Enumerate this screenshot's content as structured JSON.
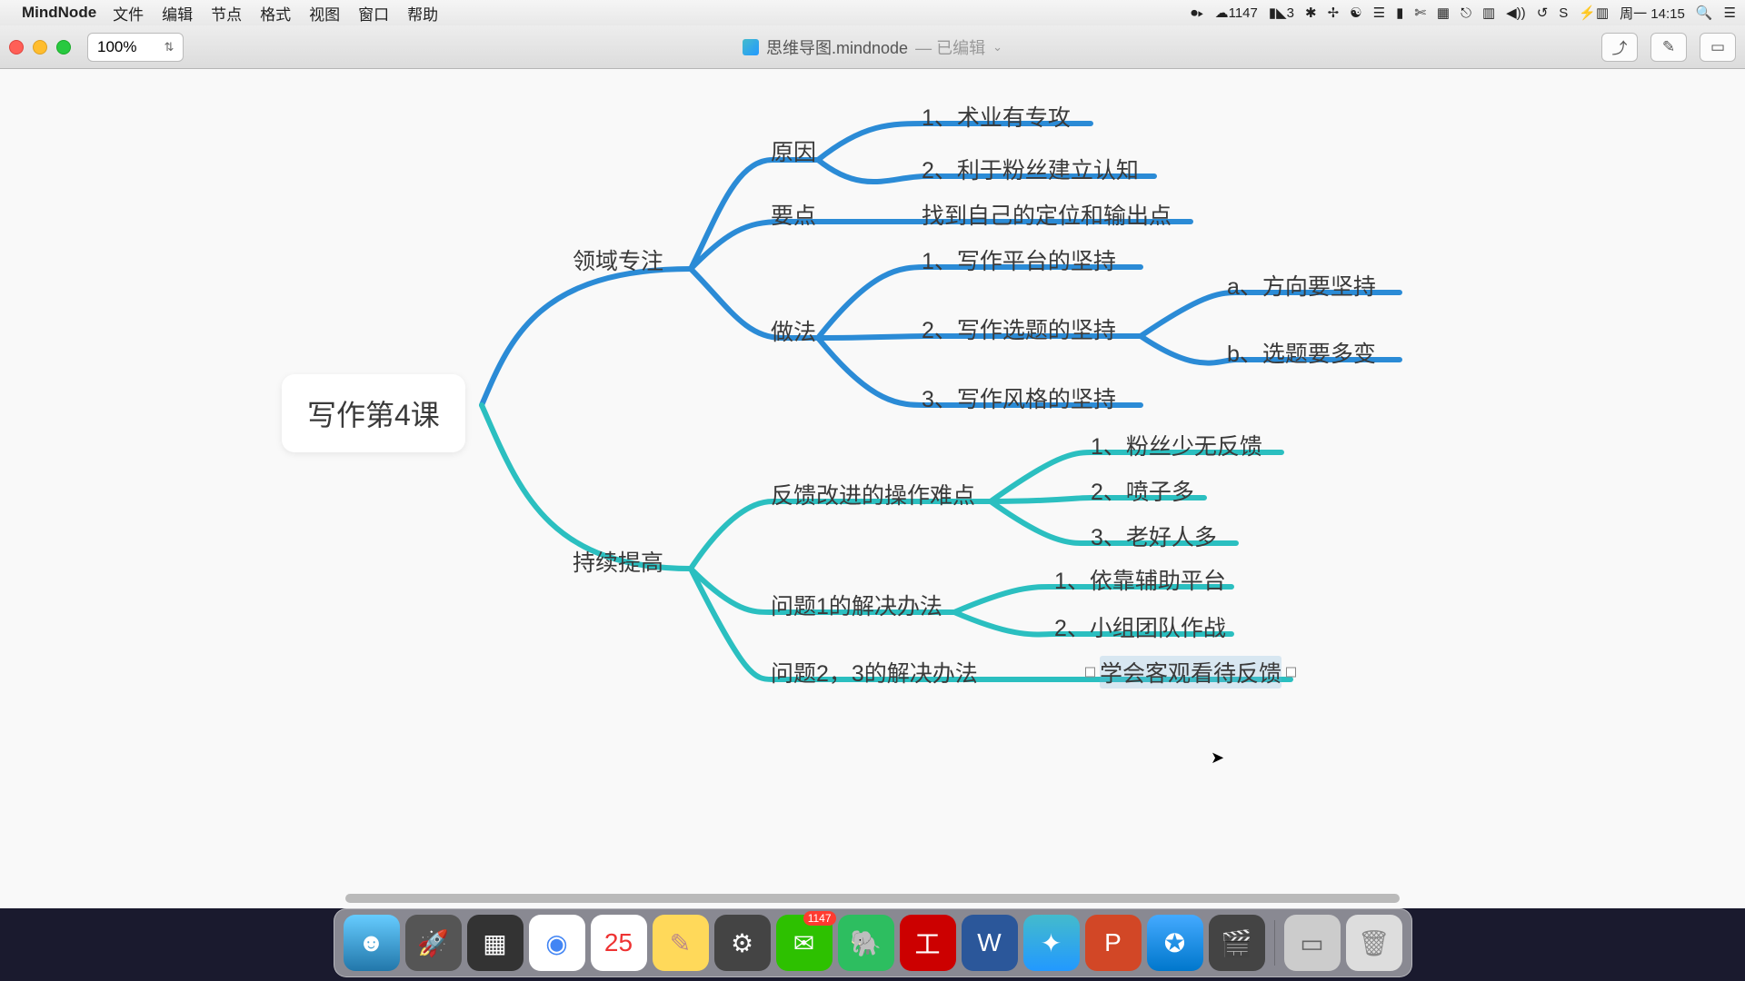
{
  "menubar": {
    "app": "MindNode",
    "items": [
      "文件",
      "编辑",
      "节点",
      "格式",
      "视图",
      "窗口",
      "帮助"
    ],
    "status": {
      "wechat": "1147",
      "adobe": "3",
      "clock": "周一  14:15"
    }
  },
  "toolbar": {
    "zoom": "100%",
    "doc_icon": "mindnode-doc-icon",
    "title": "思维导图.mindnode",
    "edited": "— 已编辑"
  },
  "mindmap": {
    "root": "写作第4课",
    "b1": {
      "label": "领域专注",
      "c1": {
        "label": "原因",
        "leaves": [
          "1、术业有专攻",
          "2、利于粉丝建立认知"
        ]
      },
      "c2": {
        "label": "要点",
        "leaf": "找到自己的定位和输出点"
      },
      "c3": {
        "label": "做法",
        "leaves": [
          "1、写作平台的坚持",
          "2、写作选题的坚持",
          "3、写作风格的坚持"
        ],
        "sub2": [
          "a、方向要坚持",
          "b、选题要多变"
        ]
      }
    },
    "b2": {
      "label": "持续提高",
      "c1": {
        "label": "反馈改进的操作难点",
        "leaves": [
          "1、粉丝少无反馈",
          "2、喷子多",
          "3、老好人多"
        ]
      },
      "c2": {
        "label": "问题1的解决办法",
        "leaves": [
          "1、依靠辅助平台",
          "2、小组团队作战"
        ]
      },
      "c3": {
        "label": "问题2，3的解决办法",
        "leaf": "学会客观看待反馈"
      }
    }
  },
  "colors": {
    "blue": "#2b8bd6",
    "teal": "#2bbfc0"
  },
  "dock_apps": [
    "Finder",
    "Launchpad",
    "MissionCtrl",
    "Chrome",
    "Calendar",
    "Notes",
    "Settings",
    "WeChat",
    "Evernote",
    "ICBC",
    "Word",
    "MindNode",
    "PowerPoint",
    "Safari",
    "iMovie",
    "ScreenFlow",
    "Trash"
  ]
}
